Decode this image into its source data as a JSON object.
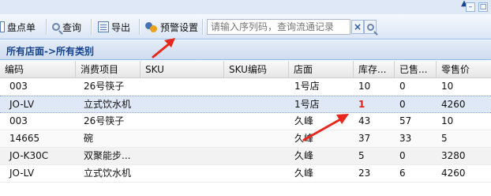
{
  "toolbar": {
    "inventory_label": "盘点单",
    "query_label": "查询",
    "export_label": "导出",
    "warning_label": "预警设置",
    "search_placeholder": "请输入序列码，查询流通记录",
    "clear_label": "×"
  },
  "panel": {
    "title": "所有店面->所有类别"
  },
  "grid": {
    "columns": [
      "编码",
      "消费项目",
      "SKU",
      "SKU编码",
      "店面",
      "库存...",
      "已售...",
      "零售价"
    ],
    "rows": [
      {
        "code": "003",
        "item": "26号筷子",
        "sku": "",
        "sku_code": "",
        "store": "1号店",
        "stock": "10",
        "sold": "0",
        "price": "10"
      },
      {
        "code": "JO-LV",
        "item": "立式饮水机",
        "sku": "",
        "sku_code": "",
        "store": "1号店",
        "stock": "1",
        "sold": "0",
        "price": "4260"
      },
      {
        "code": "003",
        "item": "26号筷子",
        "sku": "",
        "sku_code": "",
        "store": "久峰",
        "stock": "43",
        "sold": "57",
        "price": "10"
      },
      {
        "code": "14665",
        "item": "碗",
        "sku": "",
        "sku_code": "",
        "store": "久峰",
        "stock": "37",
        "sold": "33",
        "price": "5"
      },
      {
        "code": "JO-K30C",
        "item": "双聚能步...",
        "sku": "",
        "sku_code": "",
        "store": "久峰",
        "stock": "5",
        "sold": "0",
        "price": "3280"
      },
      {
        "code": "JO-LV",
        "item": "立式饮水机",
        "sku": "",
        "sku_code": "",
        "store": "久峰",
        "stock": "23",
        "sold": "6",
        "price": "4260"
      }
    ]
  },
  "colors": {
    "accent": "#15428b",
    "alert": "#e0221f",
    "selected_row": "#dfe8f6"
  }
}
